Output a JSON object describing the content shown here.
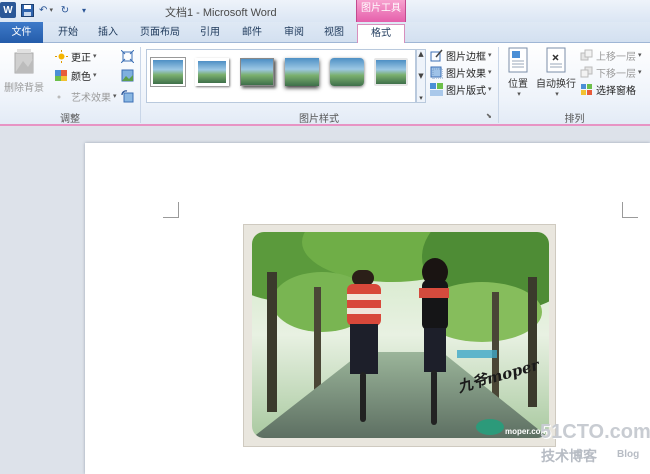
{
  "app": {
    "window_title": "文档1  -  Microsoft Word",
    "contextual_tab_group": "图片工具",
    "logo_letter": "W"
  },
  "quick_access": {
    "save_icon": "save-icon",
    "undo_icon": "undo-icon",
    "redo_icon": "redo-icon",
    "customize_icon": "customize-icon"
  },
  "tabs": [
    {
      "label": "文件"
    },
    {
      "label": "开始"
    },
    {
      "label": "插入"
    },
    {
      "label": "页面布局"
    },
    {
      "label": "引用"
    },
    {
      "label": "邮件"
    },
    {
      "label": "审阅"
    },
    {
      "label": "视图"
    },
    {
      "label": "格式"
    }
  ],
  "ribbon": {
    "adjust": {
      "remove_bg": "删除背景",
      "corrections": "更正",
      "color": "颜色",
      "artistic": "艺术效果",
      "label": "调整"
    },
    "styles": {
      "label": "图片样式",
      "border": "图片边框",
      "effects": "图片效果",
      "layout": "图片版式"
    },
    "arrange": {
      "label": "排列",
      "position": "位置",
      "wrap": "自动换行",
      "bring_forward": "上移一层",
      "send_backward": "下移一层",
      "selection_pane": "选择窗格"
    }
  },
  "document": {
    "photo_signature": "九爷moper",
    "photo_site": "moper.com",
    "watermark": "51CTO.com",
    "watermark_sub": "技术博客",
    "watermark_blog": "Blog"
  },
  "colors": {
    "file_tab": "#2b5fab",
    "contextual_accent": "#e55fab",
    "ribbon_bg": "#eef3fa"
  }
}
